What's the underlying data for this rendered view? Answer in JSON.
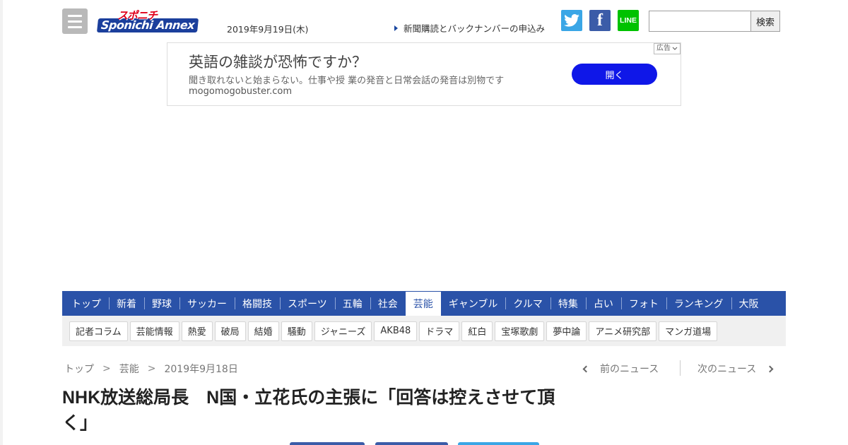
{
  "header": {
    "date": "2019年9月19日(木)",
    "logo_top": "スポニチ",
    "logo_main": "Sponichi Annex",
    "news_link": "新聞購読とバックナンバーの申込み",
    "search_button": "検索",
    "search_value": "",
    "social": [
      "twitter-icon",
      "facebook-icon",
      "line-icon"
    ],
    "line_label": "LINE",
    "fb_label": "f"
  },
  "ad": {
    "badge": "広告",
    "title": "英語の雑談が恐怖ですか？",
    "description": "聞き取れないと始まらない。仕事や授 業の発音と日常会話の発音は別物です",
    "url": "mogomogobuster.com",
    "button": "開く"
  },
  "nav": {
    "items": [
      "トップ",
      "新着",
      "野球",
      "サッカー",
      "格闘技",
      "スポーツ",
      "五輪",
      "社会",
      "芸能",
      "ギャンブル",
      "クルマ",
      "特集",
      "占い",
      "フォト",
      "ランキング",
      "大阪"
    ],
    "active": "芸能"
  },
  "subnav": {
    "items": [
      "記者コラム",
      "芸能情報",
      "熱愛",
      "破局",
      "結婚",
      "騒動",
      "ジャニーズ",
      "AKB48",
      "ドラマ",
      "紅白",
      "宝塚歌劇",
      "夢中論",
      "アニメ研究部",
      "マンガ道場"
    ]
  },
  "breadcrumb": {
    "items": [
      "トップ",
      "芸能",
      "2019年9月18日"
    ],
    "separator": ">"
  },
  "pager": {
    "prev": "前のニュース",
    "next": "次のニュース"
  },
  "article": {
    "headline": "NHK放送総局長　N国・立花氏の主張に「回答は控えさせて頂く」"
  },
  "colors": {
    "nav_bg": "#2a52a8",
    "ad_button": "#0f17e8",
    "twitter": "#3aa6e6",
    "facebook": "#3b5ca8",
    "line": "#00c200"
  }
}
